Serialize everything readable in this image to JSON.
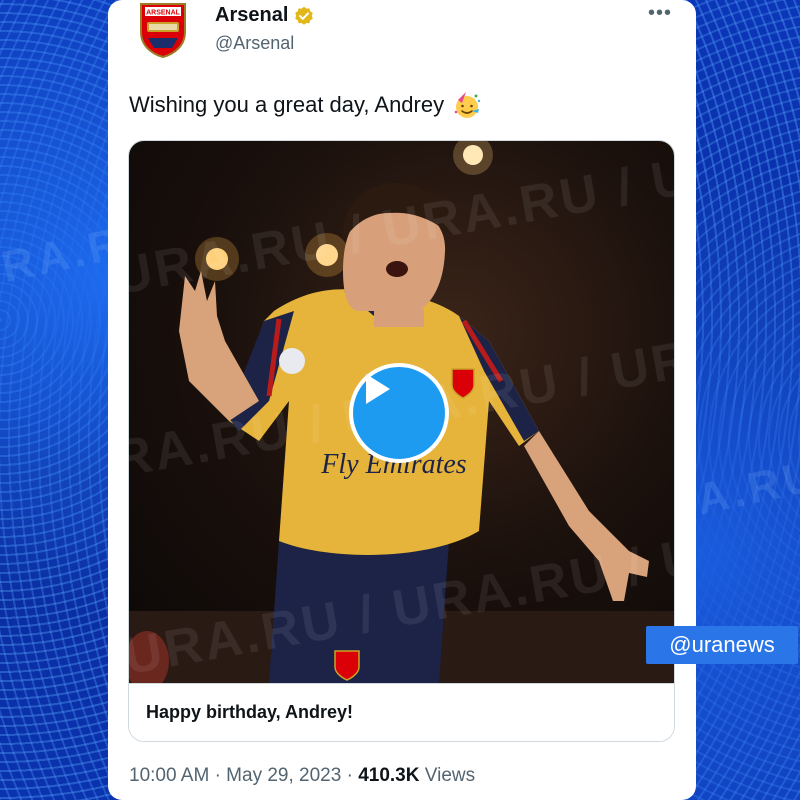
{
  "tweet": {
    "account_name": "Arsenal",
    "handle": "@Arsenal",
    "text": "Wishing you a great day, Andrey",
    "emoji": "partying-face-icon",
    "media": {
      "caption": "Happy birthday, Andrey!",
      "type": "video",
      "watermark": "URA.RU / URA.RU / URA.RU",
      "shirt_sponsor": "Fly Emirates"
    },
    "time": "10:00 AM",
    "date": "May 29, 2023",
    "views_count": "410.3K",
    "views_label": "Views",
    "separator": "·"
  },
  "badge": "@uranews",
  "colors": {
    "accent": "#1d9bf0",
    "verified": "#e2b719",
    "background": "#0a2fa8",
    "badge": "#2a76e8"
  }
}
